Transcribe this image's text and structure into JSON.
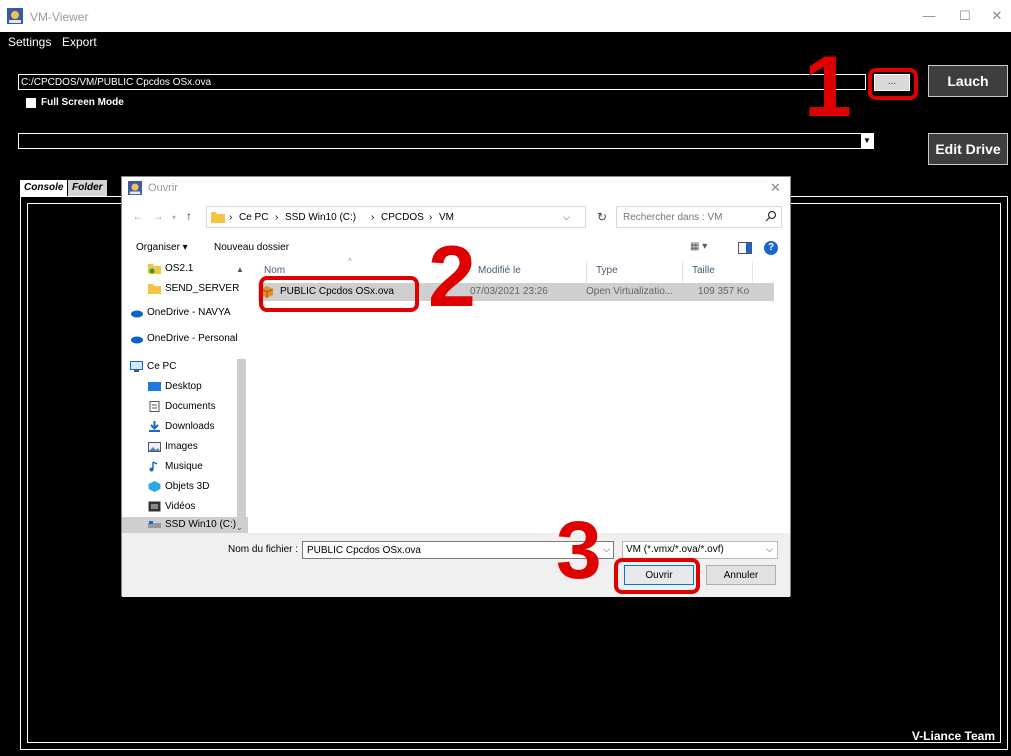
{
  "app": {
    "title": "VM-Viewer",
    "window_controls": {
      "minimize": "—",
      "maximize": "☐",
      "close": "✕"
    },
    "menu": [
      "Settings",
      "Export"
    ],
    "path_value": "C:/CPCDOS/VM/PUBLIC Cpcdos OSx.ova",
    "browse_label": "...",
    "launch_label": "Lauch",
    "fullscreen_label": "Full Screen Mode",
    "fullscreen_checked": false,
    "drive_value": "",
    "edit_drive_label": "Edit Drive",
    "tabs": [
      "Console",
      "Folder"
    ],
    "active_tab": "Console",
    "team_label": "V-Liance Team"
  },
  "dialog": {
    "title": "Ouvrir",
    "breadcrumb": [
      "Ce PC",
      "SSD Win10 (C:)",
      "CPCDOS",
      "VM"
    ],
    "search_placeholder": "Rechercher dans : VM",
    "organize_label": "Organiser ▾",
    "new_folder_label": "Nouveau dossier",
    "view_label": "▦ ▾",
    "nav_items": [
      {
        "label": "OS2.1",
        "icon": "folder-shared-icon"
      },
      {
        "label": "SEND_SERVER",
        "icon": "folder-icon"
      },
      {
        "label": "OneDrive - NAVYA",
        "icon": "onedrive-icon"
      },
      {
        "label": "OneDrive - Personal",
        "icon": "onedrive-icon"
      },
      {
        "label": "Ce PC",
        "icon": "computer-icon"
      },
      {
        "label": "Desktop",
        "icon": "desktop-icon"
      },
      {
        "label": "Documents",
        "icon": "documents-icon"
      },
      {
        "label": "Downloads",
        "icon": "downloads-icon"
      },
      {
        "label": "Images",
        "icon": "images-icon"
      },
      {
        "label": "Musique",
        "icon": "music-icon"
      },
      {
        "label": "Objets 3D",
        "icon": "objects3d-icon"
      },
      {
        "label": "Vidéos",
        "icon": "videos-icon"
      },
      {
        "label": "SSD Win10 (C:)",
        "icon": "drive-icon"
      }
    ],
    "columns": {
      "name": "Nom",
      "modified": "Modifié le",
      "type": "Type",
      "size": "Taille"
    },
    "files": [
      {
        "name": "PUBLIC Cpcdos OSx.ova",
        "modified": "07/03/2021 23:26",
        "type": "Open Virtualizatio...",
        "size": "109 357 Ko"
      }
    ],
    "filename_label": "Nom du fichier :",
    "filename_value": "PUBLIC Cpcdos OSx.ova",
    "filter_label": "VM (*.vmx/*.ova/*.ovf)",
    "open_label": "Ouvrir",
    "cancel_label": "Annuler"
  },
  "annotations": {
    "step1": "1",
    "step2": "2",
    "step3": "3",
    "color": "#e10000"
  }
}
